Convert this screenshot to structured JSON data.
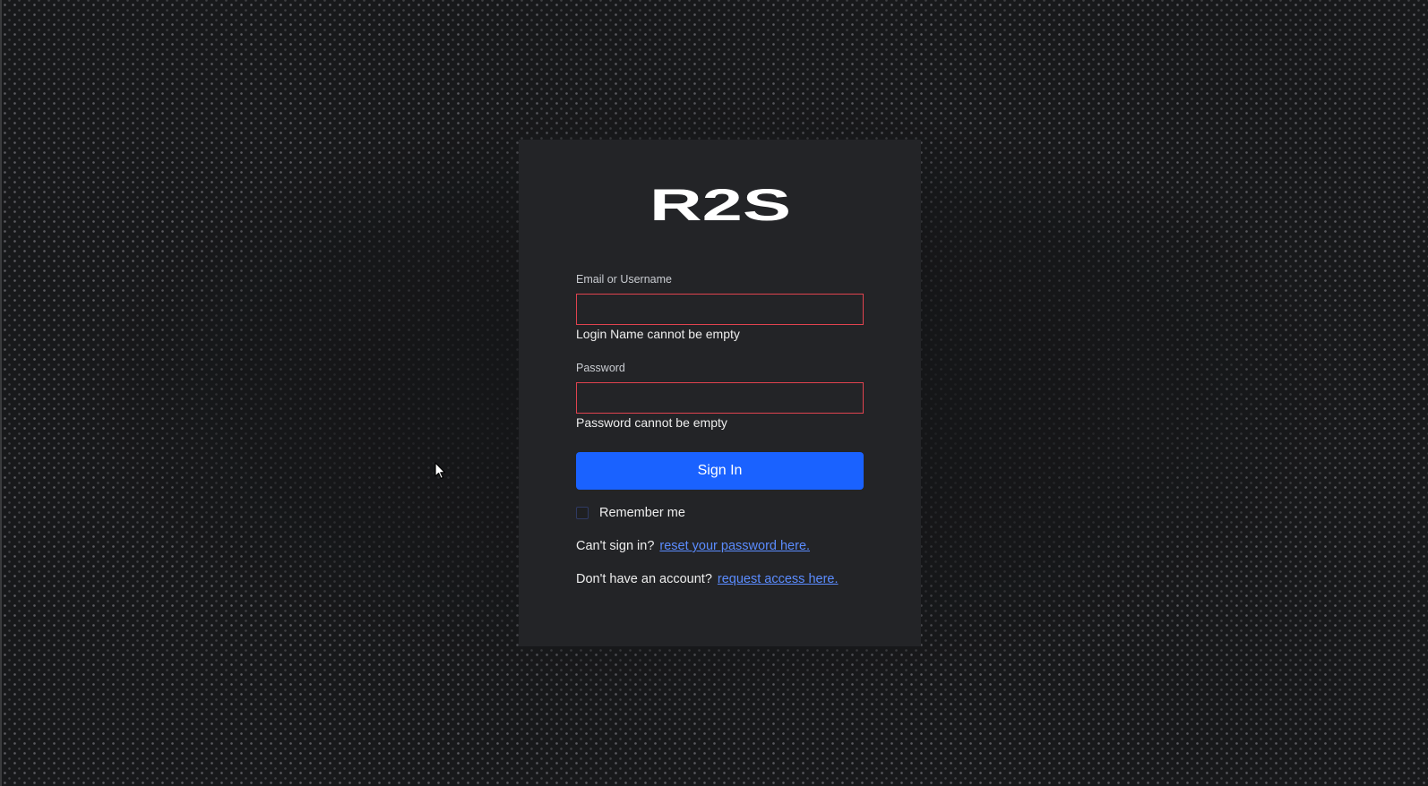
{
  "brand": {
    "logo_text": "R2S"
  },
  "login_form": {
    "email": {
      "label": "Email or Username",
      "value": "",
      "error": "Login Name cannot be empty"
    },
    "password": {
      "label": "Password",
      "value": "",
      "error": "Password cannot be empty"
    },
    "submit_label": "Sign In",
    "remember_me": {
      "label": "Remember me",
      "checked": false
    },
    "reset": {
      "prompt": "Can't sign in?",
      "link_text": "reset your password here."
    },
    "request_access": {
      "prompt": "Don't have an account?",
      "link_text": "request access here."
    }
  },
  "colors": {
    "background": "#18191b",
    "card": "#232427",
    "primary": "#1a62ff",
    "error_border": "#e0434f",
    "link": "#5b8cff"
  },
  "icons": [
    "cursor-arrow-icon"
  ]
}
